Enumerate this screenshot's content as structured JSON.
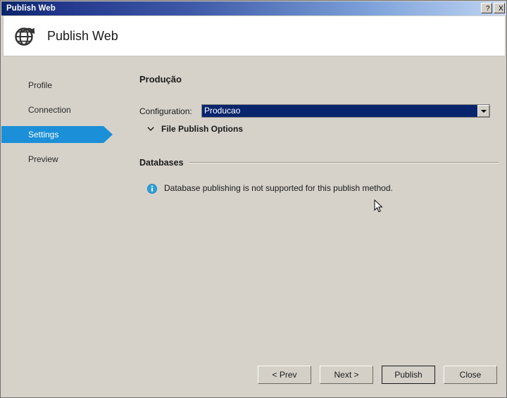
{
  "window": {
    "title": "Publish Web",
    "help_button": "?",
    "close_button": "X"
  },
  "header": {
    "title": "Publish Web",
    "icon": "globe-publish-icon"
  },
  "sidebar": {
    "items": [
      {
        "label": "Profile",
        "selected": false
      },
      {
        "label": "Connection",
        "selected": false
      },
      {
        "label": "Settings",
        "selected": true
      },
      {
        "label": "Preview",
        "selected": false
      }
    ],
    "selected_color": "#1b8fd8"
  },
  "main": {
    "section_title": "Produção",
    "configuration": {
      "label": "Configuration:",
      "value": "Producao",
      "dropdown_icon": "chevron-down-icon"
    },
    "file_publish_options": {
      "label": "File Publish Options",
      "expander_icon": "chevron-down-icon",
      "expanded": false
    },
    "databases": {
      "group_label": "Databases",
      "info_icon": "info-icon",
      "info_message": "Database publishing is not supported for this publish method.",
      "info_icon_color": "#2a9fd8"
    }
  },
  "footer": {
    "prev_label": "< Prev",
    "next_label": "Next >",
    "publish_label": "Publish",
    "close_label": "Close",
    "default_button": "Publish"
  }
}
